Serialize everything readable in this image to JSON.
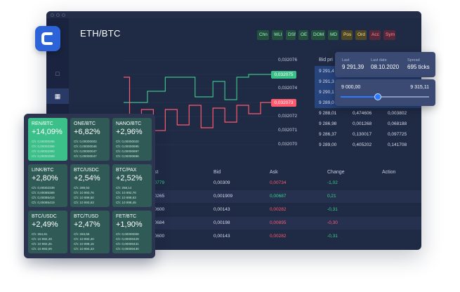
{
  "pair": "ETH/BTC",
  "chips": [
    {
      "label": "Chn",
      "tone": "green"
    },
    {
      "label": "WLI",
      "tone": "green"
    },
    {
      "label": "DSf",
      "tone": "green"
    },
    {
      "label": "OE",
      "tone": "green"
    },
    {
      "label": "DOM",
      "tone": "green"
    },
    {
      "label": "MD",
      "tone": "green"
    },
    {
      "label": "Pos",
      "tone": "yellow"
    },
    {
      "label": "Ord",
      "tone": "yellow"
    },
    {
      "label": "Acc",
      "tone": "red"
    },
    {
      "label": "Sym",
      "tone": "red"
    }
  ],
  "chart_data": {
    "type": "line",
    "y_ticks": [
      "0,032076",
      "0,032075",
      "0,032074",
      "0,032073",
      "0,032072",
      "0,032071",
      "0,032070"
    ],
    "highlight_green": "0,032075",
    "highlight_red": "0,032073",
    "ylim": [
      0.03207,
      0.032076
    ],
    "series": [
      {
        "color": "#3cc08a",
        "x": [
          0,
          1,
          2,
          3,
          4,
          5,
          6,
          7,
          8,
          9,
          10,
          11,
          12,
          13,
          14,
          15,
          16,
          17,
          18,
          19,
          20,
          21,
          22,
          23,
          24,
          25
        ],
        "y": [
          0.032073,
          0.032073,
          0.032073,
          0.032073,
          0.0320738,
          0.0320738,
          0.0320738,
          0.0320748,
          0.0320748,
          0.0320748,
          0.0320748,
          0.0320748,
          0.0320734,
          0.0320734,
          0.0320734,
          0.0320745,
          0.0320745,
          0.0320732,
          0.0320732,
          0.0320748,
          0.0320748,
          0.032075,
          0.032075,
          0.032075,
          0.032075,
          0.032075
        ]
      },
      {
        "color": "#ff5a6e",
        "x": [
          0,
          1,
          2,
          3,
          4,
          5,
          6,
          7,
          8,
          9,
          10,
          11,
          12,
          13,
          14,
          15,
          16,
          17,
          18,
          19,
          20,
          21,
          22,
          23,
          24,
          25
        ],
        "y": [
          0.0320748,
          0.0320705,
          0.0320705,
          0.0320725,
          0.0320725,
          0.032071,
          0.032071,
          0.0320725,
          0.0320725,
          0.0320714,
          0.0320714,
          0.0320728,
          0.0320728,
          0.0320712,
          0.0320712,
          0.0320726,
          0.0320726,
          0.0320716,
          0.0320716,
          0.0320728,
          0.0320728,
          0.0320722,
          0.0320722,
          0.032073,
          0.032073,
          0.032073
        ]
      }
    ]
  },
  "orderbook": {
    "header": "Bid pri",
    "rows": [
      {
        "price": "9 291,4",
        "qty": "",
        "total": "",
        "hl": true
      },
      {
        "price": "9 291,3",
        "qty": "",
        "total": "",
        "hl": true
      },
      {
        "price": "9 290,1",
        "qty": "",
        "total": "",
        "hl": true
      },
      {
        "price": "9 289,0",
        "qty": "",
        "total": "",
        "hl": true
      },
      {
        "price": "9 288,01",
        "qty": "0,474606",
        "total": "0,003802",
        "hl": false
      },
      {
        "price": "9 286,98",
        "qty": "0,001268",
        "total": "0,068188",
        "hl": false
      },
      {
        "price": "9 286,37",
        "qty": "0,130017",
        "total": "0,097725",
        "hl": false
      },
      {
        "price": "9 289,00",
        "qty": "0,405202",
        "total": "0,141708",
        "hl": false
      }
    ]
  },
  "popup": {
    "last_label": "Last",
    "last_value": "9 291,39",
    "date_label": "Last date",
    "date_value": "08.10.2020",
    "spread_label": "Spread",
    "spread_value": "695 ticks"
  },
  "slider": {
    "min": "9 000,00",
    "max": "9 315,11",
    "level": 0.42
  },
  "table": {
    "headers": [
      "ast",
      "Bid",
      "Ask",
      "Change",
      "Action"
    ],
    "rows": [
      {
        "last": "00779",
        "bid": "0,00309",
        "ask": "0,00734",
        "change": "-1,02",
        "action": "Chart",
        "last_color": "green",
        "ask_color": "red",
        "change_color": "green"
      },
      {
        "last": "00265",
        "bid": "0,001909",
        "ask": "0,00687",
        "change": "0,21",
        "action": "Chart",
        "last_color": "white",
        "ask_color": "green",
        "change_color": "green"
      },
      {
        "last": "00600",
        "bid": "0,00143",
        "ask": "0,00282",
        "change": "-0,31",
        "action": "Chart",
        "last_color": "white",
        "ask_color": "red",
        "change_color": "green"
      },
      {
        "last": "00684",
        "bid": "0,00198",
        "ask": "0,00895",
        "change": "-0,30",
        "action": "Chart",
        "last_color": "white",
        "ask_color": "red",
        "change_color": "red"
      },
      {
        "last": "00600",
        "bid": "0,00143",
        "ask": "0,00282",
        "change": "-0,31",
        "action": "Chart",
        "last_color": "white",
        "ask_color": "red",
        "change_color": "green"
      }
    ]
  },
  "heatmap": [
    {
      "name": "REN/BTC",
      "pct": "+14,09%",
      "lines": [
        "Ch: 0,00000295",
        "Ch: 0,00002386",
        "Ch: 0,00002380",
        "Ch: 0,00002369"
      ],
      "bright": true
    },
    {
      "name": "ONE/BTC",
      "pct": "+6,82%",
      "lines": [
        "Ch: 0,00000003",
        "Ch: 0,00000046",
        "Ch: 0,00000047",
        "Ch: 0,00000047"
      ],
      "bright": false
    },
    {
      "name": "NANO/BTC",
      "pct": "+2,96%",
      "lines": [
        "Ch: 0,00000020",
        "Ch: 0,00000695",
        "Ch: 0,00000697",
        "Ch: 0,00000696"
      ],
      "bright": false
    },
    {
      "name": "LINK/BTC",
      "pct": "+2,80%",
      "lines": [
        "Ch: 0,00002339",
        "Ch: 0,00085369",
        "Ch: 0,00085419",
        "Ch: 0,00085419"
      ],
      "bright": false
    },
    {
      "name": "BTC/USDC",
      "pct": "+2,54%",
      "lines": [
        "Ch: 269,53",
        "Ch: 10 893,76",
        "Ch: 10 899,50",
        "Ch: 10 893,63"
      ],
      "bright": false
    },
    {
      "name": "BTC/PAX",
      "pct": "+2,52%",
      "lines": [
        "Ch: 268,14",
        "Ch: 10 892,76",
        "Ch: 10 898,63",
        "Ch: 10 898,45"
      ],
      "bright": false
    },
    {
      "name": "BTC/USDC",
      "pct": "+2,49%",
      "lines": [
        "Ch: 264,81",
        "Ch: 10 892,49",
        "Ch: 10 892,25",
        "Ch: 10 893,09"
      ],
      "bright": false
    },
    {
      "name": "BTC/TUSD",
      "pct": "+2,47%",
      "lines": [
        "Ch: 263,55",
        "Ch: 10 892,40",
        "Ch: 10 898,16",
        "Ch: 10 894,33"
      ],
      "bright": false
    },
    {
      "name": "FET/BTC",
      "pct": "+1,90%",
      "lines": [
        "Ch: 0,00000008",
        "Ch: 0,00000429",
        "Ch: 0,00000431",
        "Ch: 0,00000430"
      ],
      "bright": false
    }
  ]
}
